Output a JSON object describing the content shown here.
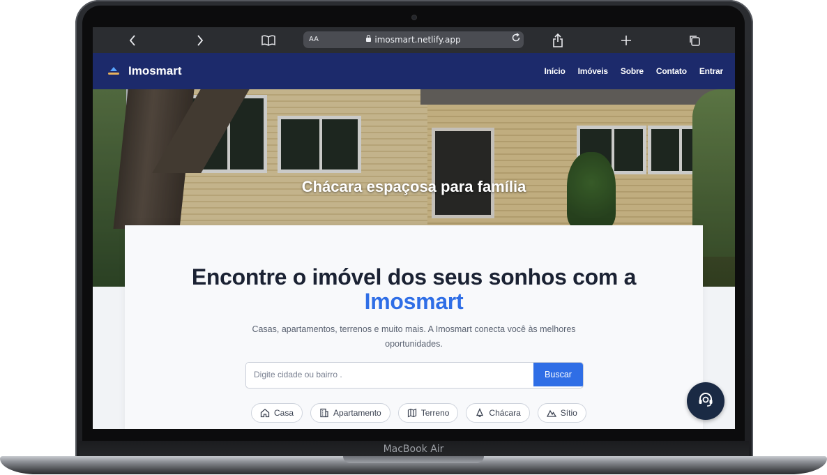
{
  "device": {
    "model_label": "MacBook Air"
  },
  "browser": {
    "url": "imosmart.netlify.app",
    "text_size_label": "AA",
    "back_icon": "chevron-left-icon",
    "forward_icon": "chevron-right-icon",
    "reader_icon": "book-icon",
    "reload_icon": "reload-icon",
    "share_icon": "share-icon",
    "new_tab_icon": "plus-icon",
    "tabs_icon": "tabs-icon"
  },
  "site": {
    "brand_name": "Imosmart",
    "nav": [
      {
        "label": "Início"
      },
      {
        "label": "Imóveis"
      },
      {
        "label": "Sobre"
      },
      {
        "label": "Contato"
      },
      {
        "label": "Entrar"
      }
    ]
  },
  "hero": {
    "caption": "Chácara espaçosa para família"
  },
  "main": {
    "headline": "Encontre o imóvel dos seus sonhos com a",
    "headline_accent": "Imosmart",
    "subtitle": "Casas, apartamentos, terrenos e muito mais. A Imosmart conecta você às melhores oportunidades.",
    "search": {
      "placeholder": "Digite cidade ou bairro .",
      "value": "",
      "button_label": "Buscar"
    },
    "categories": [
      {
        "label": "Casa",
        "icon": "house-icon"
      },
      {
        "label": "Apartamento",
        "icon": "building-icon"
      },
      {
        "label": "Terreno",
        "icon": "map-icon"
      },
      {
        "label": "Chácara",
        "icon": "bell-icon"
      },
      {
        "label": "Sítio",
        "icon": "mountain-icon"
      }
    ]
  },
  "chat": {
    "icon": "support-headset-icon"
  },
  "colors": {
    "nav_bg": "#1c2a6b",
    "accent": "#2f6ee6",
    "fab_bg": "#1a2a44"
  }
}
